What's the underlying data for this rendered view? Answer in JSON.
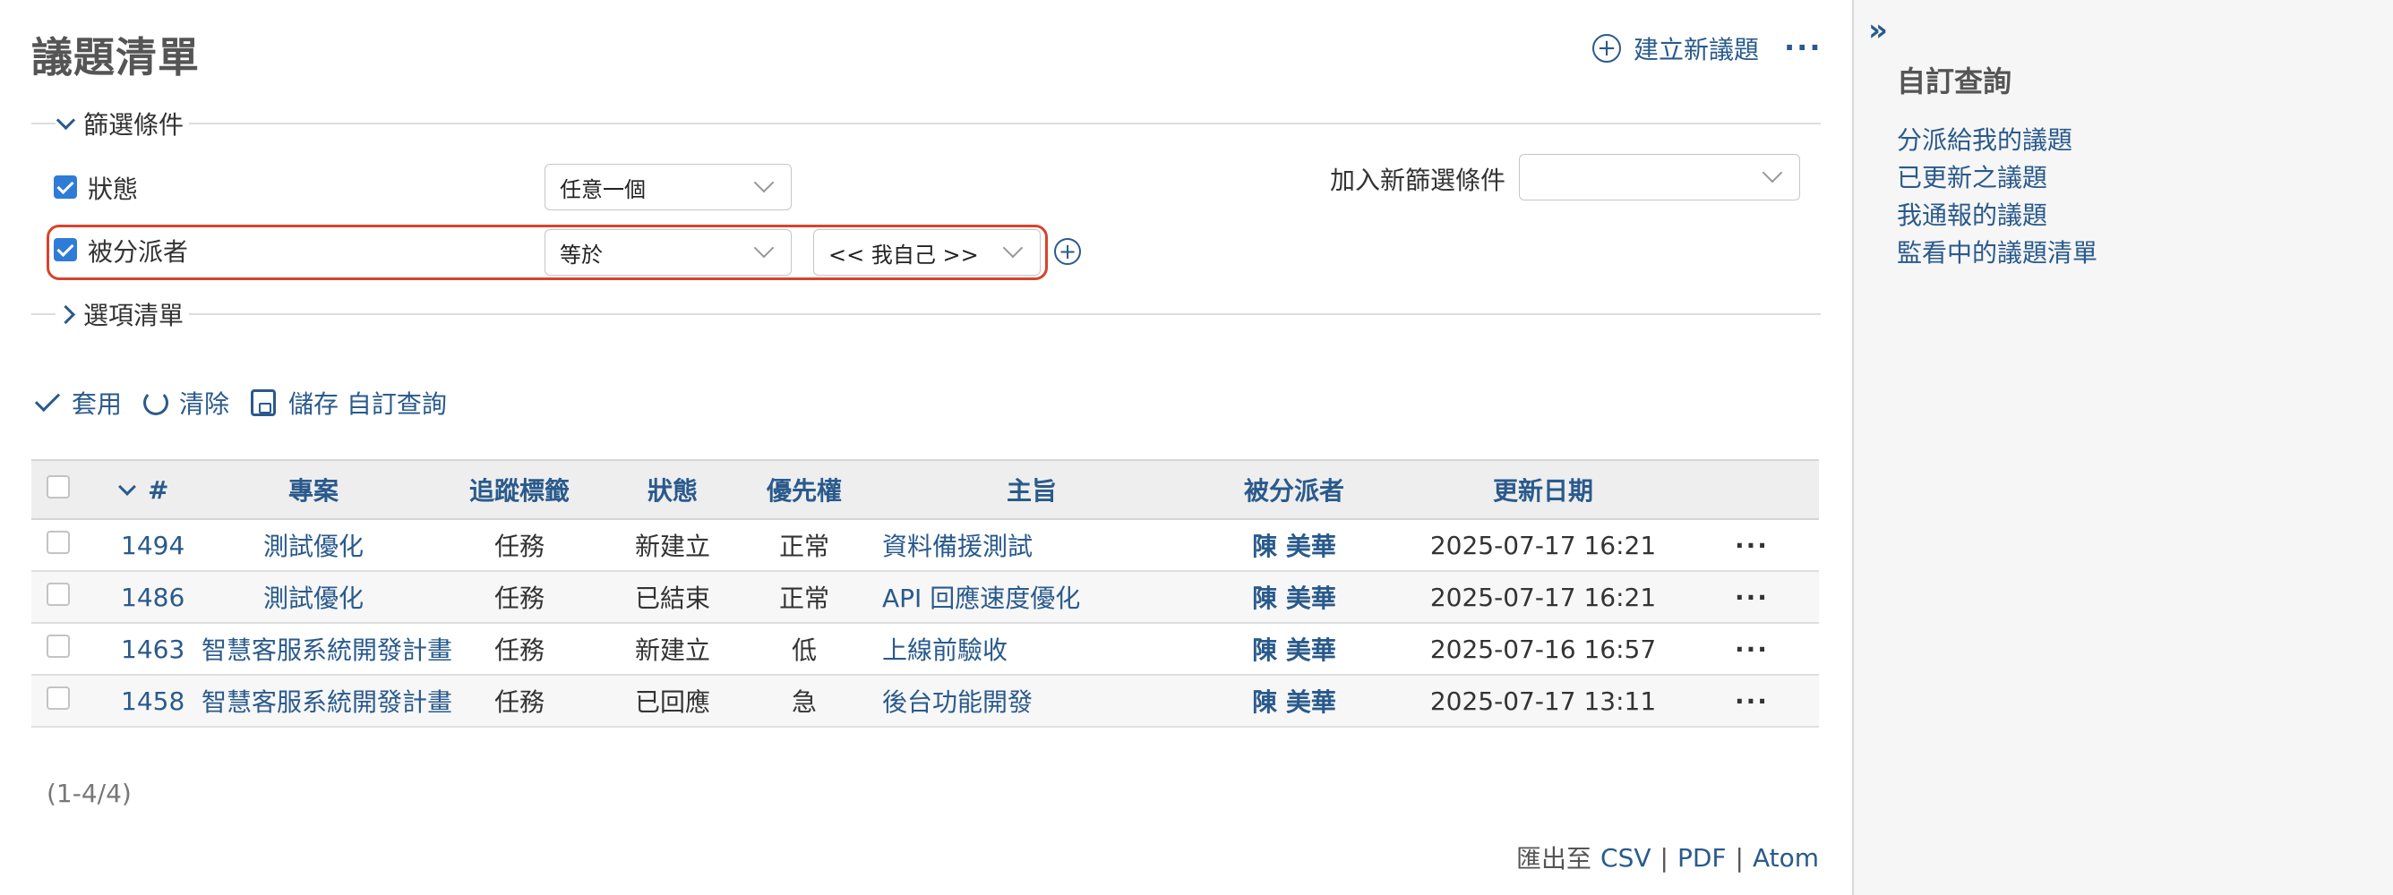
{
  "header": {
    "title": "議題清單",
    "new_issue": "建立新議題",
    "new_issue_icon": "plus-circle-icon",
    "more": "···"
  },
  "filters": {
    "legend": "篩選條件",
    "rows": [
      {
        "label": "狀態",
        "checked": true,
        "operator": "任意一個",
        "value": ""
      },
      {
        "label": "被分派者",
        "checked": true,
        "operator": "等於",
        "value": "<< 我自己 >>"
      }
    ],
    "add_filter_label": "加入新篩選條件",
    "add_filter_value": "",
    "add_value_button": "+"
  },
  "options": {
    "legend": "選項清單"
  },
  "actions": {
    "apply": "套用",
    "clear": "清除",
    "save": "儲存 自訂查詢"
  },
  "table": {
    "columns": [
      "#",
      "專案",
      "追蹤標籤",
      "狀態",
      "優先權",
      "主旨",
      "被分派者",
      "更新日期"
    ],
    "rows": [
      {
        "id": "1494",
        "project": "測試優化",
        "tracker": "任務",
        "status": "新建立",
        "priority": "正常",
        "subject": "資料備援測試",
        "assignee": "陳 美華",
        "updated": "2025-07-17 16:21"
      },
      {
        "id": "1486",
        "project": "測試優化",
        "tracker": "任務",
        "status": "已結束",
        "priority": "正常",
        "subject": "API 回應速度優化",
        "assignee": "陳 美華",
        "updated": "2025-07-17 16:21"
      },
      {
        "id": "1463",
        "project": "智慧客服系統開發計畫",
        "tracker": "任務",
        "status": "新建立",
        "priority": "低",
        "subject": "上線前驗收",
        "assignee": "陳 美華",
        "updated": "2025-07-16 16:57"
      },
      {
        "id": "1458",
        "project": "智慧客服系統開發計畫",
        "tracker": "任務",
        "status": "已回應",
        "priority": "急",
        "subject": "後台功能開發",
        "assignee": "陳 美華",
        "updated": "2025-07-17 13:11"
      }
    ],
    "row_more": "···"
  },
  "pagination": "(1-4/4)",
  "export": {
    "prefix": "匯出至",
    "csv": "CSV",
    "pdf": "PDF",
    "atom": "Atom",
    "sep": "|"
  },
  "sidebar": {
    "toggle": "»",
    "title": "自訂查詢",
    "items": [
      "分派給我的議題",
      "已更新之議題",
      "我通報的議題",
      "監看中的議題清單"
    ]
  },
  "colors": {
    "link": "#2a5a8c",
    "checkbox": "#2f7bd8",
    "highlight": "#d9432b",
    "table_header_bg": "#eeeeee",
    "sidebar_bg": "#f6f6f6"
  }
}
